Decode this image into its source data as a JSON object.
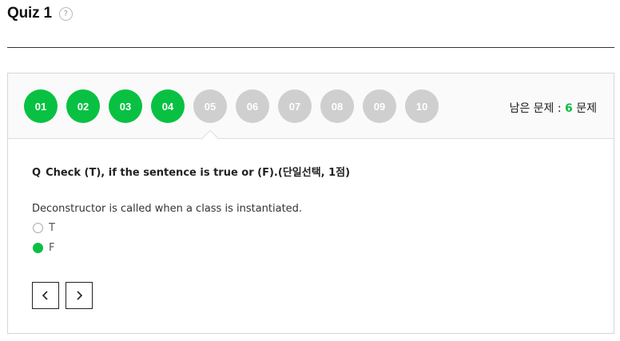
{
  "header": {
    "title": "Quiz 1",
    "help_glyph": "?"
  },
  "question_nav": {
    "items": [
      {
        "label": "01",
        "status": "answered"
      },
      {
        "label": "02",
        "status": "answered"
      },
      {
        "label": "03",
        "status": "answered"
      },
      {
        "label": "04",
        "status": "answered"
      },
      {
        "label": "05",
        "status": "unanswered"
      },
      {
        "label": "06",
        "status": "unanswered"
      },
      {
        "label": "07",
        "status": "unanswered"
      },
      {
        "label": "08",
        "status": "unanswered"
      },
      {
        "label": "09",
        "status": "unanswered"
      },
      {
        "label": "10",
        "status": "unanswered"
      }
    ],
    "current": "05"
  },
  "remaining": {
    "prefix": "남은 문제 :",
    "count": "6",
    "suffix": "문제"
  },
  "question": {
    "marker": "Q",
    "text": "Check (T), if the sentence is true or (F).(단일선택, 1점)",
    "statement": "Deconstructor is called when a class is instantiated.",
    "options": [
      {
        "label": "T",
        "selected": false
      },
      {
        "label": "F",
        "selected": true
      }
    ]
  },
  "colors": {
    "accent": "#08c142",
    "inactive": "#cfcfcf"
  },
  "icons": {
    "prev": "chevron-left-icon",
    "next": "chevron-right-icon",
    "help": "question-circle-icon"
  }
}
